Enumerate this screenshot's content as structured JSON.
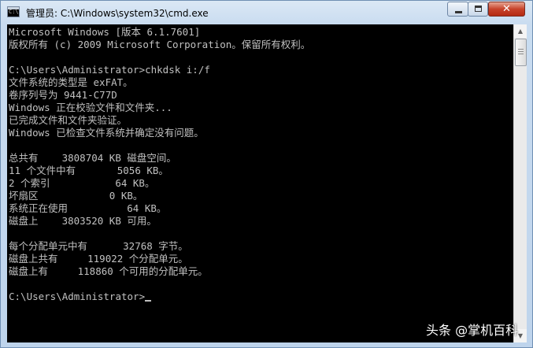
{
  "window": {
    "title": "管理员: C:\\Windows\\system32\\cmd.exe",
    "icon": "cmd-icon",
    "icon_label": "C:\\",
    "controls": {
      "minimize_icon": "minimize-icon",
      "maximize_icon": "maximize-icon",
      "close_icon": "close-icon",
      "close_glyph": "✕"
    }
  },
  "console": {
    "lines": [
      "Microsoft Windows [版本 6.1.7601]",
      "版权所有 (c) 2009 Microsoft Corporation。保留所有权利。",
      "",
      "C:\\Users\\Administrator>chkdsk i:/f",
      "文件系统的类型是 exFAT。",
      "卷序列号为 9441-C77D",
      "Windows 正在校验文件和文件夹...",
      "已完成文件和文件夹验证。",
      "Windows 已检查文件系统并确定没有问题。",
      "",
      "总共有    3808704 KB 磁盘空间。",
      "11 个文件中有       5056 KB。",
      "2 个索引           64 KB。",
      "坏扇区            0 KB。",
      "系统正在使用          64 KB。",
      "磁盘上    3803520 KB 可用。",
      "",
      "每个分配单元中有      32768 字节。",
      "磁盘上共有     119022 个分配单元。",
      "磁盘上有     118860 个可用的分配单元。",
      "",
      "C:\\Users\\Administrator>"
    ],
    "text_color": "#c0c0c0",
    "background_color": "#000000"
  },
  "scrollbar": {
    "up_arrow_icon": "scroll-up-arrow-icon",
    "down_arrow_icon": "scroll-down-arrow-icon",
    "up_glyph": "▲",
    "down_glyph": "▼"
  },
  "watermark": {
    "text": "头条 @掌机百科"
  }
}
